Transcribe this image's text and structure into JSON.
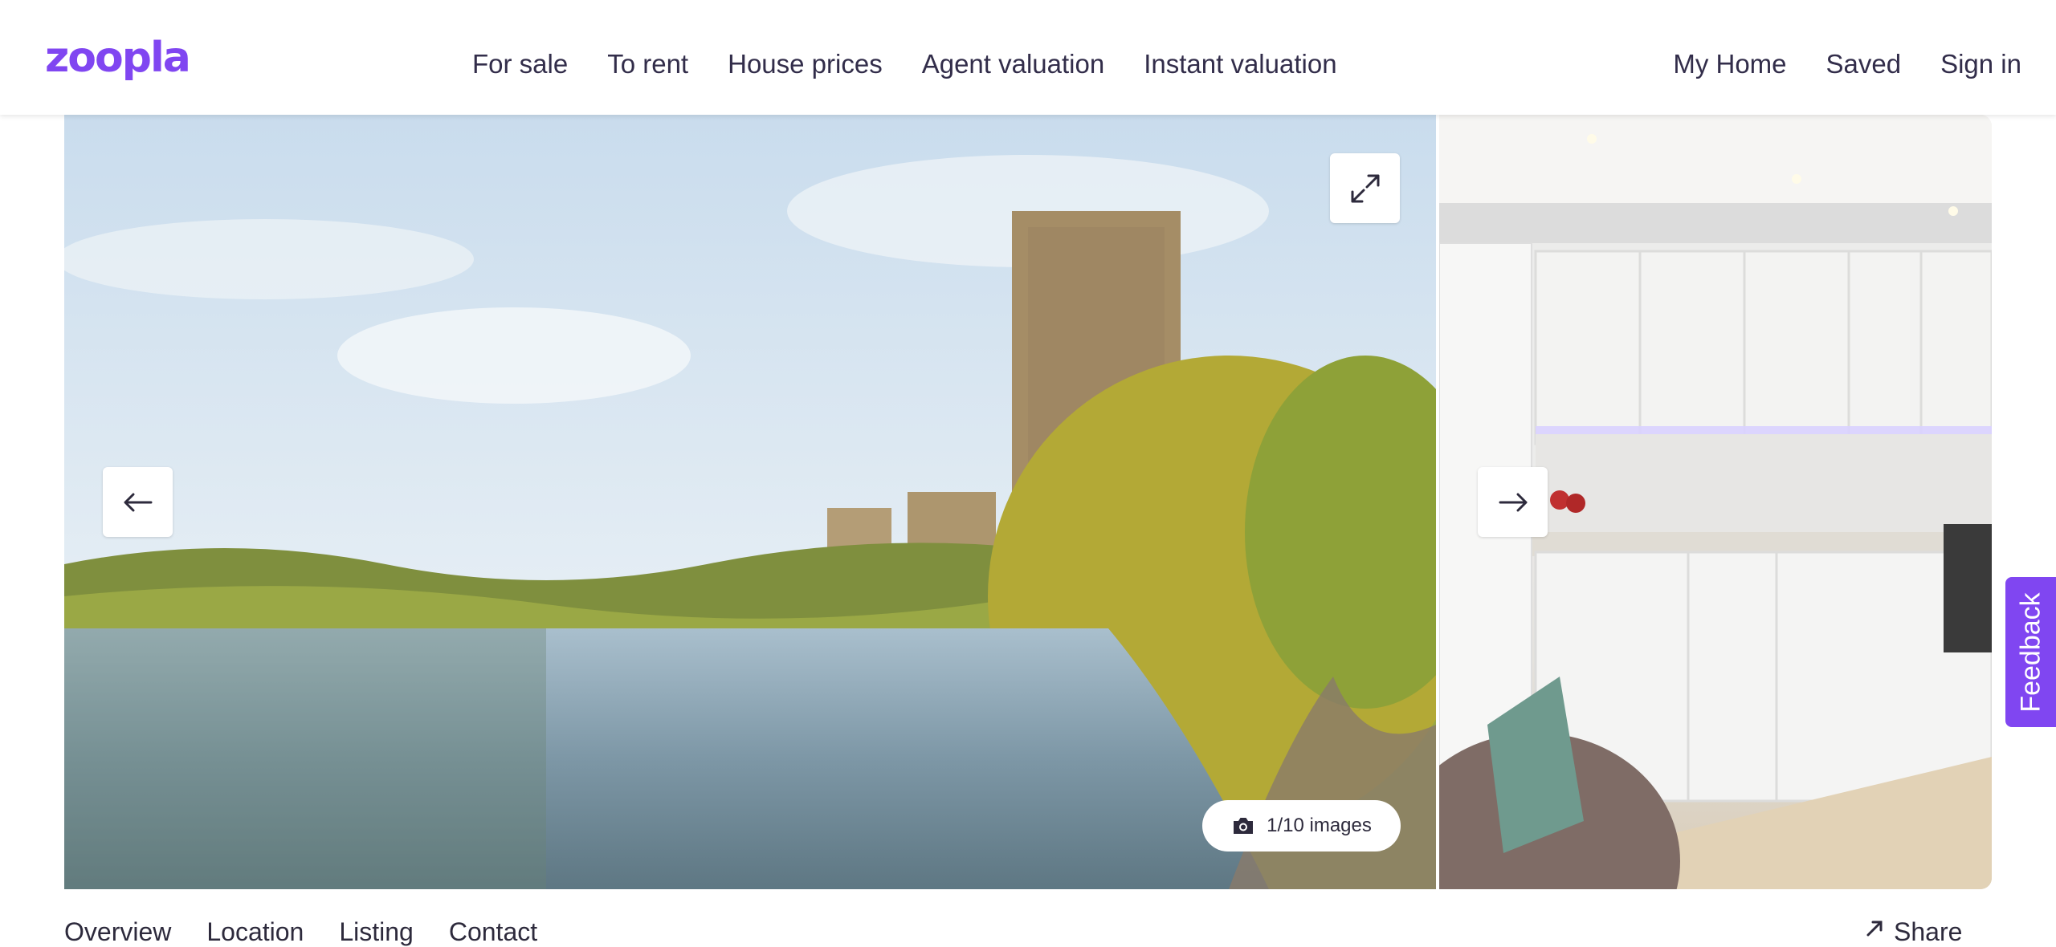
{
  "header": {
    "logo": "zoopla",
    "nav": [
      "For sale",
      "To rent",
      "House prices",
      "Agent valuation",
      "Instant valuation"
    ],
    "nav_right": [
      "My Home",
      "Saved",
      "Sign in"
    ],
    "brand_color": "#8046f1"
  },
  "gallery": {
    "image_count": "1/10 images",
    "icons": [
      "expand-icon",
      "arrow-left-icon",
      "arrow-right-icon",
      "camera-icon"
    ]
  },
  "feedback": {
    "label": "Feedback"
  },
  "subnav": {
    "items": [
      "Overview",
      "Location",
      "Listing",
      "Contact"
    ],
    "share_label": "Share"
  }
}
